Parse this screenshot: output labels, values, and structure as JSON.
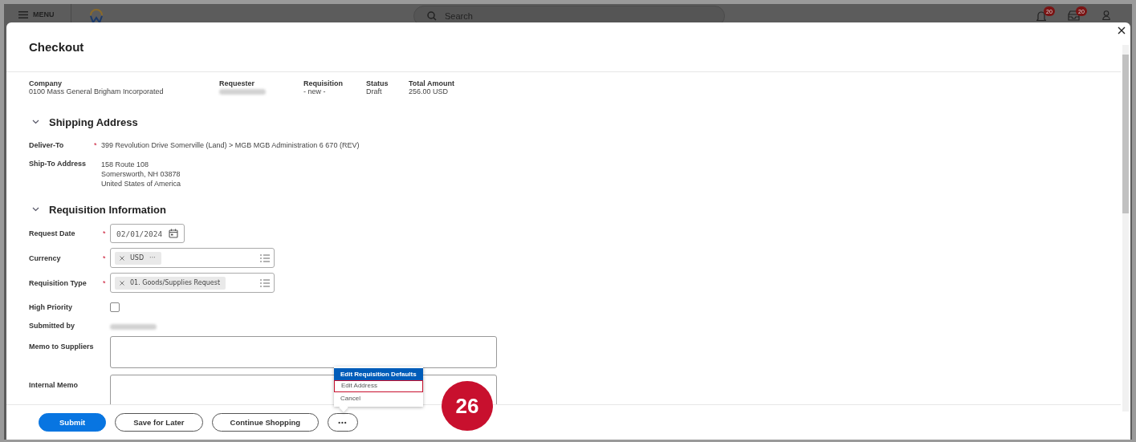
{
  "top_bar": {
    "menu_label": "MENU",
    "search": {
      "placeholder": "Search"
    },
    "notifications_badge": "20",
    "inbox_badge": "20"
  },
  "dialog": {
    "title": "Checkout",
    "summary": [
      {
        "label": "Company",
        "kind": "text",
        "value": "0100 Mass General Brigham Incorporated"
      },
      {
        "label": "Requester",
        "kind": "redacted"
      },
      {
        "label": "Requisition",
        "kind": "text",
        "value": "- new -"
      },
      {
        "label": "Status",
        "kind": "text",
        "value": "Draft"
      },
      {
        "label": "Total Amount",
        "kind": "text",
        "value": "256.00 USD"
      }
    ],
    "sections": [
      {
        "title": "Shipping Address",
        "expanded": true,
        "fields": [
          {
            "label": "Deliver-To",
            "kind": "text",
            "required_mark": "*",
            "lines": [
              "399 Revolution Drive Somerville (Land) > MGB MGB Administration 6 670 (REV)"
            ]
          },
          {
            "label": "Ship-To Address",
            "kind": "text",
            "lines": [
              "158 Route 108",
              "Somersworth, NH 03878",
              "United States of America"
            ]
          }
        ]
      },
      {
        "title": "Requisition Information",
        "expanded": true,
        "fields": [
          {
            "label": "Request Date",
            "kind": "date",
            "required_mark": "*",
            "value": "02/01/2024"
          },
          {
            "label": "Currency",
            "kind": "multiselect",
            "required_mark": "*",
            "tags": [
              {
                "label": "USD",
                "suffix": "···"
              }
            ]
          },
          {
            "label": "Requisition Type",
            "kind": "multiselect",
            "required_mark": "*",
            "tags": [
              {
                "label": "01. Goods/Supplies Request"
              }
            ]
          },
          {
            "label": "High Priority",
            "kind": "checkbox",
            "checked": false
          },
          {
            "label": "Submitted by",
            "kind": "redacted"
          },
          {
            "label": "Memo to Suppliers",
            "kind": "textarea"
          },
          {
            "label": "Internal Memo",
            "kind": "textarea"
          }
        ]
      }
    ],
    "menu": [
      {
        "label": "Edit Requisition Defaults",
        "selected": true,
        "highlighted": false
      },
      {
        "label": "Edit Address",
        "selected": false,
        "highlighted": true
      },
      {
        "label": "Cancel",
        "selected": false,
        "highlighted": false
      }
    ],
    "buttons": [
      {
        "label": "Submit",
        "kind": "primary"
      },
      {
        "label": "Save for Later",
        "kind": "secondary"
      },
      {
        "label": "Continue Shopping",
        "kind": "secondary"
      },
      {
        "label": "•••",
        "kind": "more"
      }
    ]
  },
  "step_badge": "26"
}
